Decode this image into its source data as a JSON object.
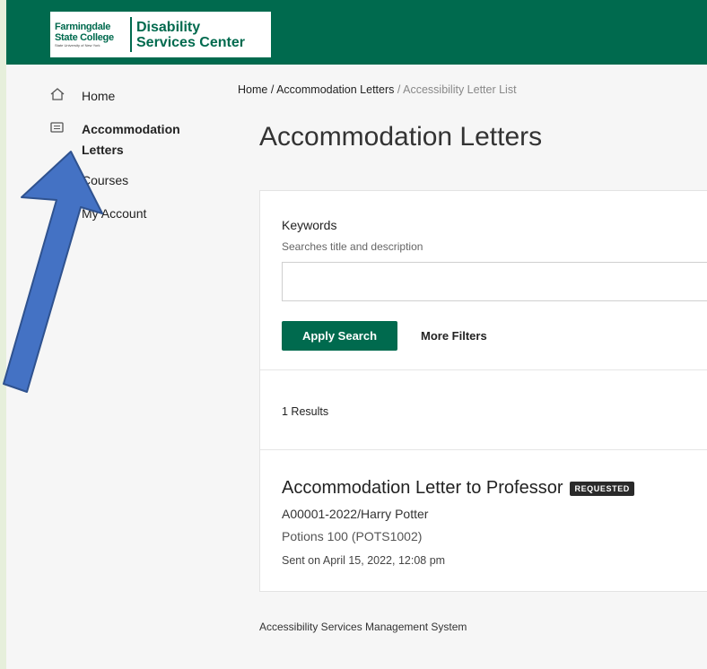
{
  "logo": {
    "line1": "Farmingdale",
    "line2": "State College",
    "line3": "State University of New York",
    "name_line1": "Disability",
    "name_line2": "Services Center"
  },
  "sidebar": {
    "items": [
      {
        "label": "Home",
        "icon": "home-icon"
      },
      {
        "label": "Accommodation Letters",
        "icon": "letter-icon",
        "active": true
      },
      {
        "label": "Courses"
      },
      {
        "label": "My Account"
      }
    ]
  },
  "breadcrumb": {
    "home": "Home",
    "sep1": " / ",
    "section": "Accommodation Letters",
    "sep2": " / ",
    "current": "Accessibility Letter List"
  },
  "page_title": "Accommodation Letters",
  "search": {
    "label": "Keywords",
    "help": "Searches title and description",
    "value": "",
    "placeholder": "",
    "apply_label": "Apply Search",
    "more_filters_label": "More Filters"
  },
  "results_count": "1 Results",
  "letters": [
    {
      "title": "Accommodation Letter to Professor",
      "status": "REQUESTED",
      "reference": "A00001-2022/Harry Potter",
      "course": "Potions 100 (POTS1002)",
      "sent": "Sent on April 15, 2022, 12:08 pm"
    }
  ],
  "footer": "Accessibility Services Management System",
  "colors": {
    "brand": "#006a4e",
    "annotation_arrow": "#4472c4",
    "outer_background": "#e6efdb"
  }
}
